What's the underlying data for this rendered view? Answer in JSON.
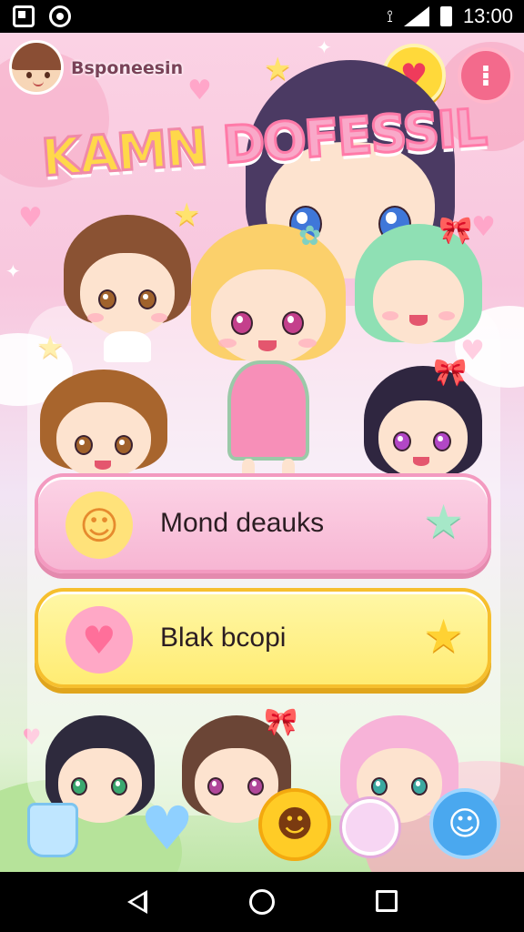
{
  "status_bar": {
    "time": "13:00",
    "left_icons": [
      "photo-icon",
      "circle-app-icon"
    ],
    "right_icons": [
      "vibrate-icon",
      "signal-icon",
      "battery-icon"
    ]
  },
  "profile": {
    "username": "Bsponeesin"
  },
  "header_buttons": {
    "heart_icon": "heart-icon",
    "menu_icon": "menu-icon"
  },
  "title": {
    "part1": "KAMN",
    "part2": "DOFESSIL"
  },
  "menu": [
    {
      "label": "Mond deauks",
      "left_icon": "smiley-sun-icon",
      "right_icon": "star-icon"
    },
    {
      "label": "Blak bcopi",
      "left_icon": "hearts-icon",
      "right_icon": "star-icon"
    }
  ],
  "colors": {
    "bg_pink": "#fbd2e4",
    "accent_yellow": "#ffd93a",
    "accent_pink": "#f36a8c",
    "card_pink": "#f7b6d3",
    "card_yellow": "#ffec73",
    "emoji_blue": "#4aa8ef"
  }
}
